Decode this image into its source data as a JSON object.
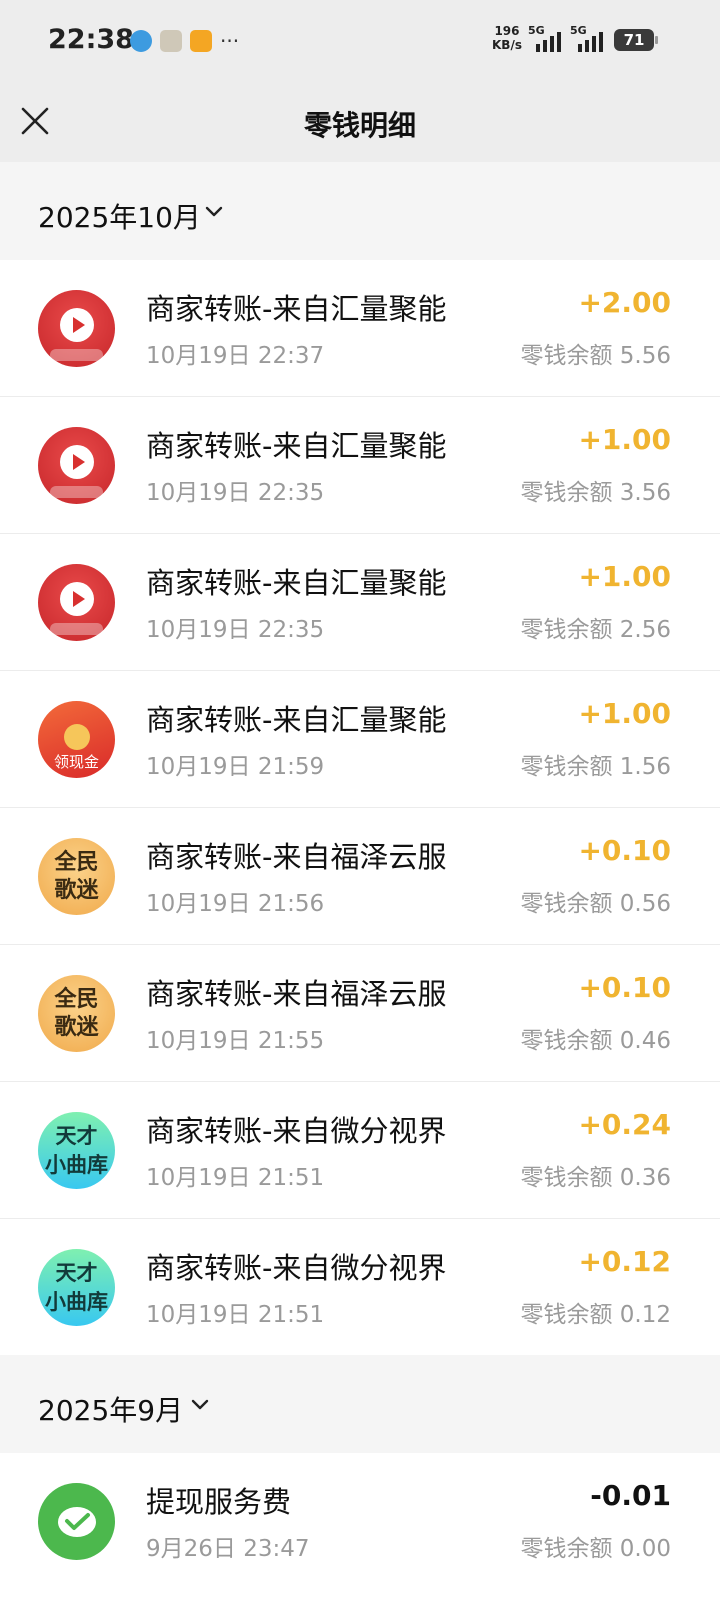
{
  "status_bar": {
    "time": "22:38",
    "net_speed_value": "196",
    "net_speed_unit": "KB/s",
    "signal_1_label": "5G",
    "signal_2_label": "5G",
    "battery": "71",
    "icons": [
      "telegram-icon",
      "mascot-icon",
      "mail-icon",
      "more-icon"
    ]
  },
  "nav": {
    "title": "零钱明细",
    "close_icon": "close-icon"
  },
  "months": [
    {
      "label": "2025年10月",
      "records": [
        {
          "title": "商家转账-来自汇量聚能",
          "time": "10月19日 22:37",
          "amount": "+2.00",
          "balance": "零钱余额 5.56",
          "avatar": "red-play"
        },
        {
          "title": "商家转账-来自汇量聚能",
          "time": "10月19日 22:35",
          "amount": "+1.00",
          "balance": "零钱余额 3.56",
          "avatar": "red-play"
        },
        {
          "title": "商家转账-来自汇量聚能",
          "time": "10月19日 22:35",
          "amount": "+1.00",
          "balance": "零钱余额 2.56",
          "avatar": "red-play"
        },
        {
          "title": "商家转账-来自汇量聚能",
          "time": "10月19日 21:59",
          "amount": "+1.00",
          "balance": "零钱余额 1.56",
          "avatar": "red-envelope",
          "avatar_text": "领现金"
        },
        {
          "title": "商家转账-来自福泽云服",
          "time": "10月19日 21:56",
          "amount": "+0.10",
          "balance": "零钱余额 0.56",
          "avatar": "orange",
          "avatar_line1": "全民",
          "avatar_line2": "歌迷"
        },
        {
          "title": "商家转账-来自福泽云服",
          "time": "10月19日 21:55",
          "amount": "+0.10",
          "balance": "零钱余额 0.46",
          "avatar": "orange",
          "avatar_line1": "全民",
          "avatar_line2": "歌迷"
        },
        {
          "title": "商家转账-来自微分视界",
          "time": "10月19日 21:51",
          "amount": "+0.24",
          "balance": "零钱余额 0.36",
          "avatar": "teal",
          "avatar_line1": "天才",
          "avatar_line2": "小曲库"
        },
        {
          "title": "商家转账-来自微分视界",
          "time": "10月19日 21:51",
          "amount": "+0.12",
          "balance": "零钱余额 0.12",
          "avatar": "teal",
          "avatar_line1": "天才",
          "avatar_line2": "小曲库"
        }
      ]
    },
    {
      "label": "2025年9月",
      "records": [
        {
          "title": "提现服务费",
          "time": "9月26日 23:47",
          "amount": "-0.01",
          "balance": "零钱余额 0.00",
          "avatar": "wechat"
        }
      ]
    }
  ],
  "colors": {
    "positive_amount": "#f0b430",
    "negative_amount": "#111111",
    "page_bg": "#ededed",
    "month_bg": "#f5f5f5"
  }
}
